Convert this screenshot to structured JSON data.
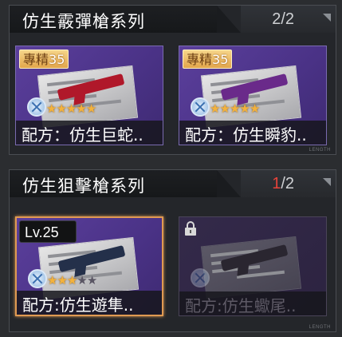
{
  "sections": [
    {
      "title": "仿生霰彈槍系列",
      "count_current": "2",
      "count_sep": "/2",
      "count_current_color": "#cfd1d4",
      "cards": [
        {
          "badge_prefix": "專精",
          "badge_num": "35",
          "stars_on": 5,
          "stars_total": 5,
          "label": "配方：仿生巨蛇..",
          "gun_color": "#b0182a",
          "locked": false
        },
        {
          "badge_prefix": "專精",
          "badge_num": "35",
          "stars_on": 5,
          "stars_total": 5,
          "label": "配方：仿生瞬豹..",
          "gun_color": "#6a2a8a",
          "locked": false
        }
      ]
    },
    {
      "title": "仿生狙擊槍系列",
      "count_current": "1",
      "count_sep": "/2",
      "count_current_color": "#e8433a",
      "cards": [
        {
          "level": "Lv.25",
          "stars_on": 3,
          "stars_total": 5,
          "label": "配方:仿生遊隼..",
          "gun_color": "#24304a",
          "locked": false,
          "selected": true
        },
        {
          "stars_on": 0,
          "stars_total": 0,
          "label": "配方:仿生蠍尾..",
          "gun_color": "#2a2630",
          "locked": true,
          "lock_icon": "padlock-icon"
        }
      ]
    }
  ],
  "footer_tag": "LENGTH",
  "colors": {
    "accent_orange": "#e09a52",
    "star_gold": "#f3b23c",
    "card_purple": "#4a3286"
  }
}
